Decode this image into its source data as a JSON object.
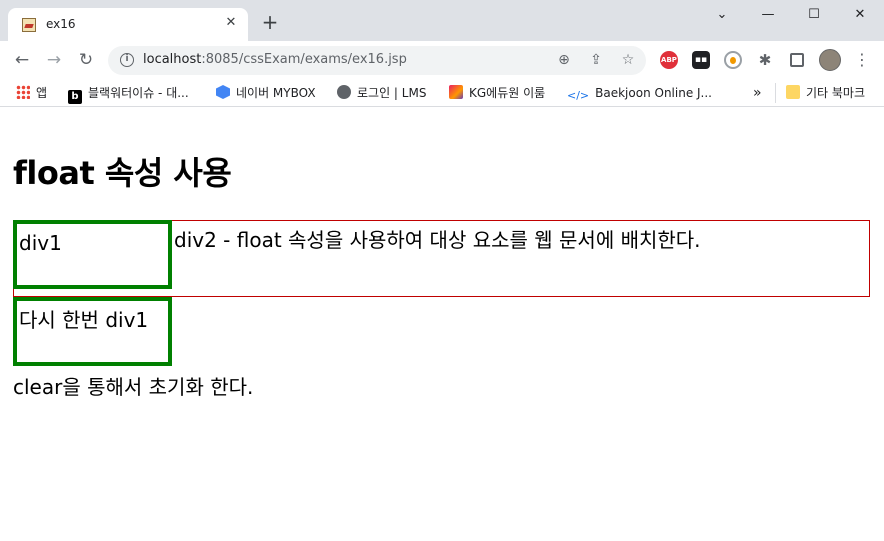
{
  "browser": {
    "tab": {
      "title": "ex16",
      "close_glyph": "✕"
    },
    "new_tab_glyph": "+",
    "window_controls": {
      "tabsearch": "⌄",
      "minimize": "—",
      "maximize": "☐",
      "close": "✕"
    },
    "nav": {
      "back": "←",
      "forward": "→",
      "reload": "↻"
    },
    "address": {
      "host": "localhost",
      "rest": ":8085/cssExam/exams/ex16.jsp"
    },
    "omnibox_icons": [
      "zoom-icon",
      "share-icon",
      "bookmark-star-icon"
    ],
    "extensions": {
      "abp": "ABP",
      "tm": "▪▪"
    },
    "menu_glyph": "⋮",
    "bookmarks": [
      {
        "label": "앱",
        "icon": "apps-grid-icon"
      },
      {
        "label": "블랙워터이슈 - 대...",
        "icon": "b-logo-icon"
      },
      {
        "label": "네이버 MYBOX",
        "icon": "naver-mybox-icon"
      },
      {
        "label": "로그인 | LMS",
        "icon": "globe-icon"
      },
      {
        "label": "KG에듀원 이룸",
        "icon": "kg-logo-icon"
      },
      {
        "label": "Baekjoon Online J...",
        "icon": "code-bracket-icon"
      }
    ],
    "bookmarks_overflow": "»",
    "other_bookmarks": "기타 북마크"
  },
  "page": {
    "heading": "float 속성 사용",
    "div1_first": "div1",
    "div2": "div2 - float 속성을 사용하여 대상 요소를 웹 문서에 배치한다.",
    "div1_second": "다시 한번 div1",
    "clear_text": "clear을 통해서 초기화 한다."
  }
}
